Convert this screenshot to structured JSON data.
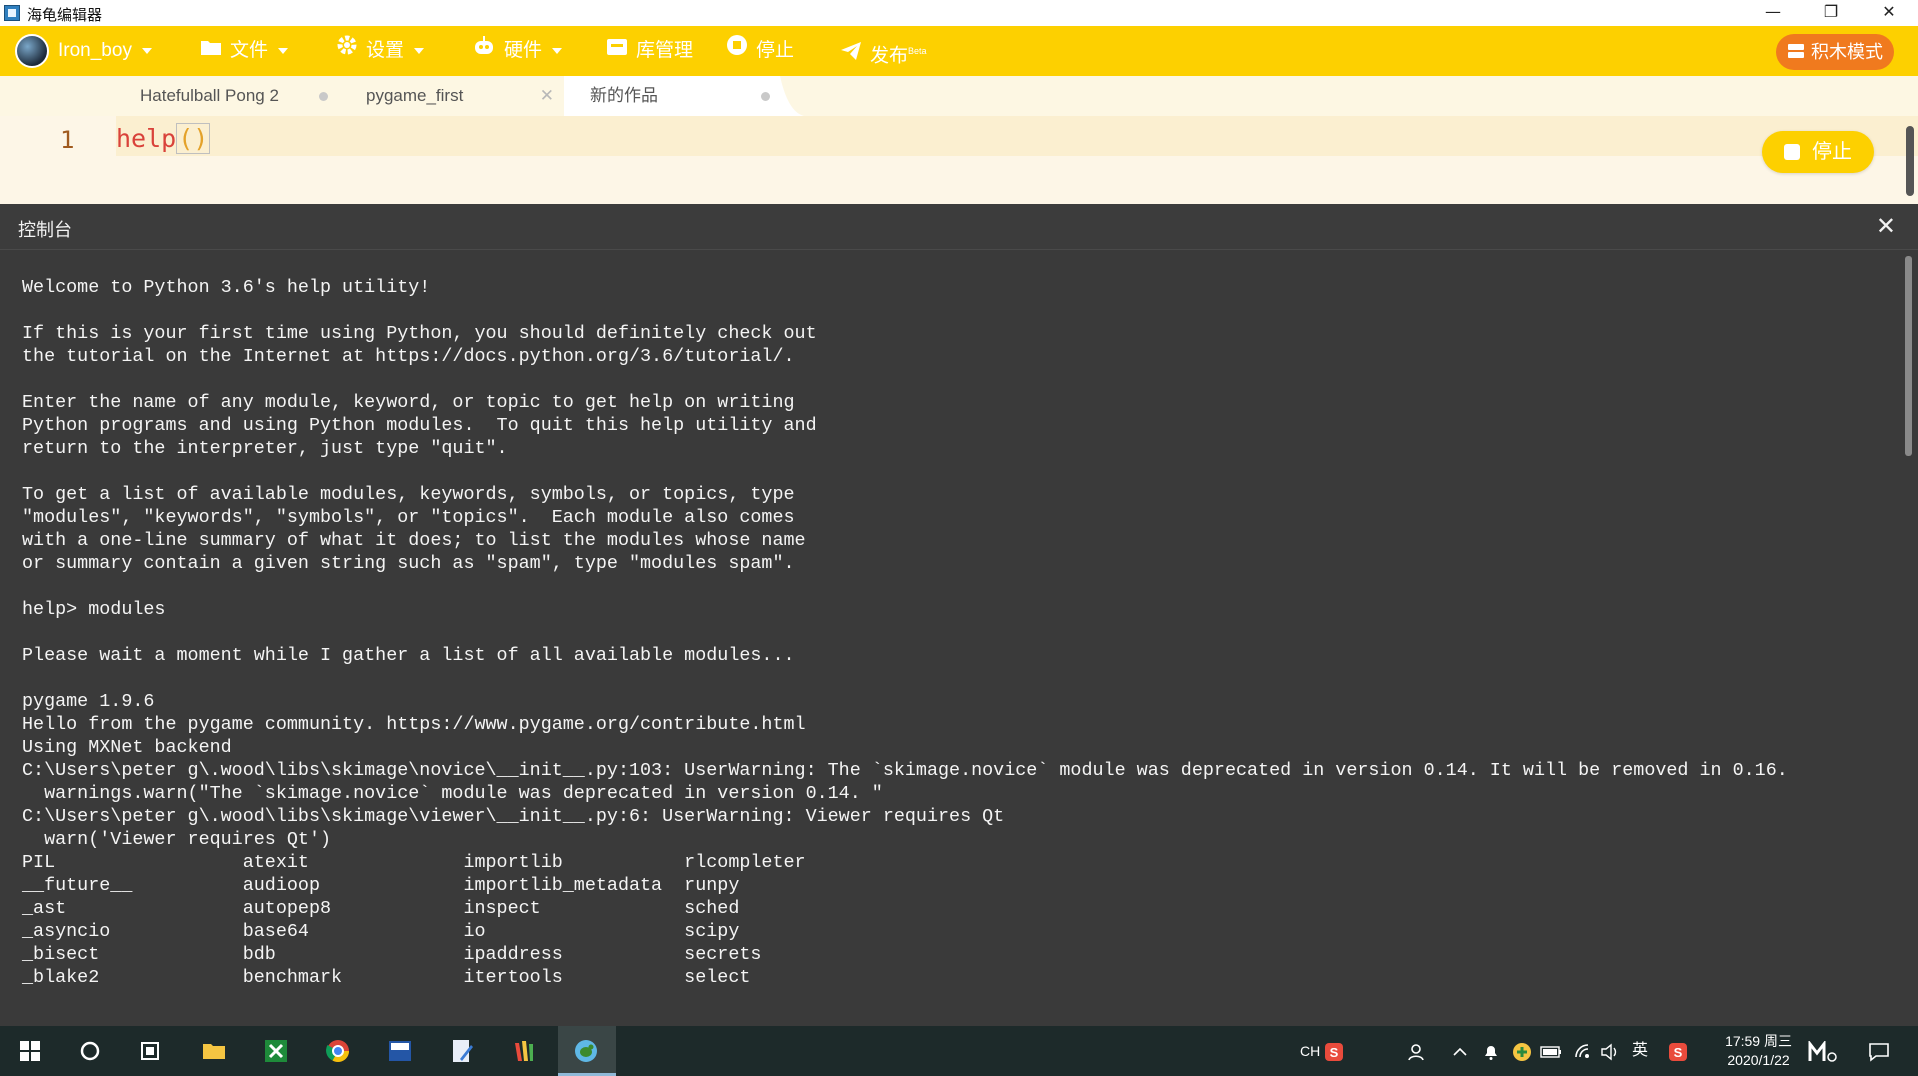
{
  "window": {
    "title": "海龟编辑器",
    "minimize": "—",
    "restore": "❐",
    "close": "✕"
  },
  "toolbar": {
    "user": "Iron_boy",
    "file": "文件",
    "settings": "设置",
    "hardware": "硬件",
    "library": "库管理",
    "stop": "停止",
    "publish": "发布",
    "publish_badge": "Beta",
    "block_mode": "积木模式",
    "accent": "#fdd000",
    "block_mode_color": "#f07a1e"
  },
  "tabs": [
    {
      "label": "Hatefulball Pong 2"
    },
    {
      "label": "pygame_first"
    },
    {
      "label": "新的作品"
    }
  ],
  "editor": {
    "line_number": "1",
    "code_func": "help",
    "code_parens": "()",
    "stop_button": "停止"
  },
  "console": {
    "title": "控制台",
    "close": "✕",
    "lines": [
      "Welcome to Python 3.6's help utility!",
      "",
      "If this is your first time using Python, you should definitely check out",
      "the tutorial on the Internet at https://docs.python.org/3.6/tutorial/.",
      "",
      "Enter the name of any module, keyword, or topic to get help on writing",
      "Python programs and using Python modules.  To quit this help utility and",
      "return to the interpreter, just type \"quit\".",
      "",
      "To get a list of available modules, keywords, symbols, or topics, type",
      "\"modules\", \"keywords\", \"symbols\", or \"topics\".  Each module also comes",
      "with a one-line summary of what it does; to list the modules whose name",
      "or summary contain a given string such as \"spam\", type \"modules spam\".",
      "",
      "help> modules",
      "",
      "Please wait a moment while I gather a list of all available modules...",
      "",
      "pygame 1.9.6",
      "Hello from the pygame community. https://www.pygame.org/contribute.html",
      "Using MXNet backend",
      "C:\\Users\\peter g\\.wood\\libs\\skimage\\novice\\__init__.py:103: UserWarning: The `skimage.novice` module was deprecated in version 0.14. It will be removed in 0.16.",
      "  warnings.warn(\"The `skimage.novice` module was deprecated in version 0.14. \"",
      "C:\\Users\\peter g\\.wood\\libs\\skimage\\viewer\\__init__.py:6: UserWarning: Viewer requires Qt",
      "  warn('Viewer requires Qt')",
      "PIL                 atexit              importlib           rlcompleter",
      "__future__          audioop             importlib_metadata  runpy",
      "_ast                autopep8            inspect             sched",
      "_asyncio            base64              io                  scipy",
      "_bisect             bdb                 ipaddress           secrets",
      "_blake2             benchmark           itertools           select"
    ]
  },
  "taskbar": {
    "ime_lang": "CH",
    "ime_mode": "英",
    "time": "17:59 周三",
    "date": "2020/1/22",
    "icons": [
      "windows-start-icon",
      "search-circle-icon",
      "task-view-icon",
      "file-explorer-icon",
      "excel-icon",
      "chrome-icon",
      "dev-cpp-icon",
      "notepad-icon",
      "pencil-app-icon",
      "turtle-editor-icon"
    ]
  }
}
